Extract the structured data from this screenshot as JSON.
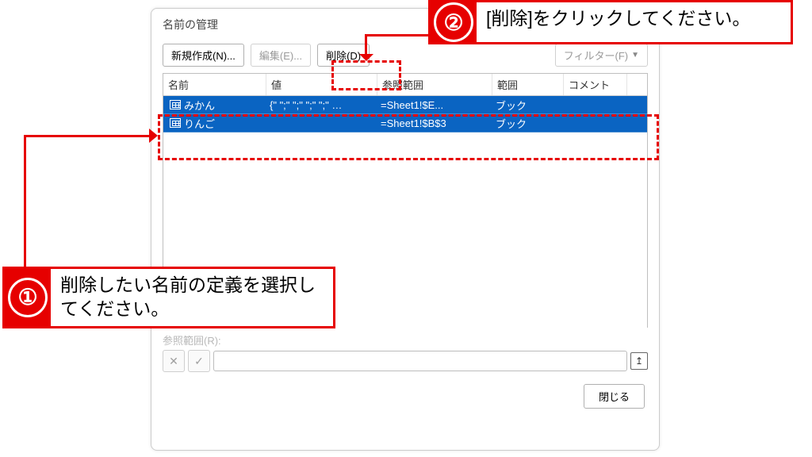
{
  "dialog": {
    "title": "名前の管理",
    "buttons": {
      "new": "新規作成(N)...",
      "edit": "編集(E)...",
      "delete": "削除(D)",
      "filter": "フィルター(F)",
      "close": "閉じる"
    },
    "columns": {
      "name": "名前",
      "value": "値",
      "ref": "参照範囲",
      "scope": "範囲",
      "comment": "コメント"
    },
    "rows": [
      {
        "name": "みかん",
        "value": "{\" \";\" \";\" \";\" \";\" …",
        "ref": "=Sheet1!$E...",
        "scope": "ブック",
        "comment": ""
      },
      {
        "name": "りんご",
        "value": "",
        "ref": "=Sheet1!$B$3",
        "scope": "ブック",
        "comment": ""
      }
    ],
    "ref_label": "参照範囲(R):"
  },
  "callouts": {
    "one_num": "①",
    "two_num": "②",
    "c1_text": "削除したい名前の定義を選択してください。",
    "c2_text": "[削除]をクリックしてください。"
  }
}
